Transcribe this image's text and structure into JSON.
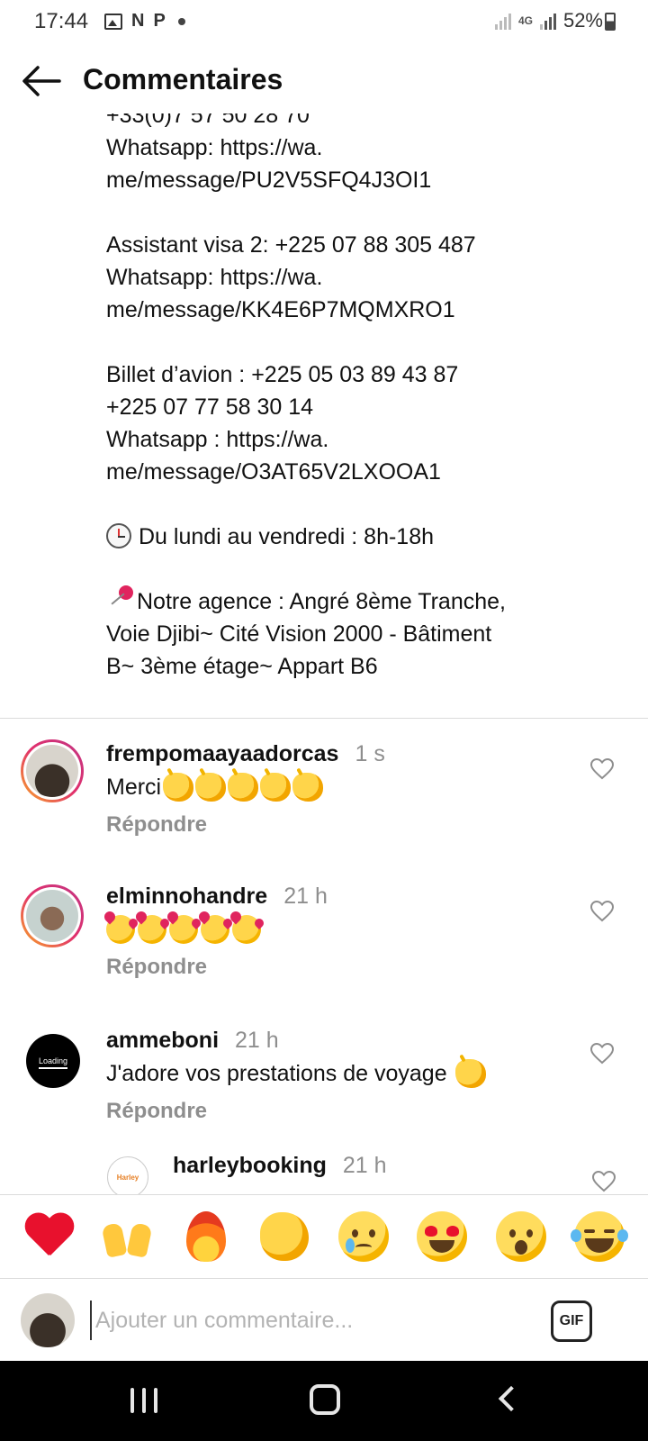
{
  "status_bar": {
    "time": "17:44",
    "left_icons": [
      "image-icon",
      "nyt-icon",
      "p-icon",
      "dot"
    ],
    "n_label": "N",
    "p_label": "P",
    "network": "4G",
    "battery": "52%"
  },
  "header": {
    "title": "Commentaires"
  },
  "caption": {
    "line_partial": "+33(0)7 57 50 28 70",
    "whatsapp_1": "Whatsapp: https://wa.\nme/message/PU2V5SFQ4J3OI1",
    "visa_2": "Assistant visa 2: +225 07 88 305 487\nWhatsapp: https://wa.\nme/message/KK4E6P7MQMXRO1",
    "billet": "Billet d’avion : +225 05 03 89 43 87\n+225 07 77 58 30 14\nWhatsapp : https://wa.\nme/message/O3AT65V2LXOOA1",
    "hours": "Du lundi au vendredi : 8h-18h",
    "agency": "Notre agence : Angré 8ème Tranche,\nVoie Djibi~ Cité Vision 2000 - Bâtiment\nB~ 3ème étage~ Appart B6"
  },
  "comments": [
    {
      "username": "frempomaayaadorcas",
      "time": "1 s",
      "text": "Merci",
      "emoji_count": 5,
      "reply": "Répondre"
    },
    {
      "username": "elminnohandre",
      "time": "21 h",
      "text": "",
      "emoji_count": 5,
      "reply": "Répondre"
    },
    {
      "username": "ammeboni",
      "time": "21 h",
      "text": "J'adore vos prestations de voyage",
      "emoji_count": 1,
      "reply": "Répondre",
      "avatar_text": "Loading"
    },
    {
      "username": "harleybooking",
      "time": "21 h",
      "avatar_text": "Harley"
    }
  ],
  "reactions": [
    "red-heart",
    "raising-hands",
    "fire",
    "clapping-hands",
    "crying-face",
    "heart-eyes",
    "surprised-face",
    "tears-of-joy"
  ],
  "composer": {
    "placeholder": "Ajouter un commentaire...",
    "gif_label": "GIF"
  },
  "colors": {
    "accent_heart": "#e8112d",
    "muted_text": "#8e8e8e",
    "nav_bar": "#000000"
  }
}
